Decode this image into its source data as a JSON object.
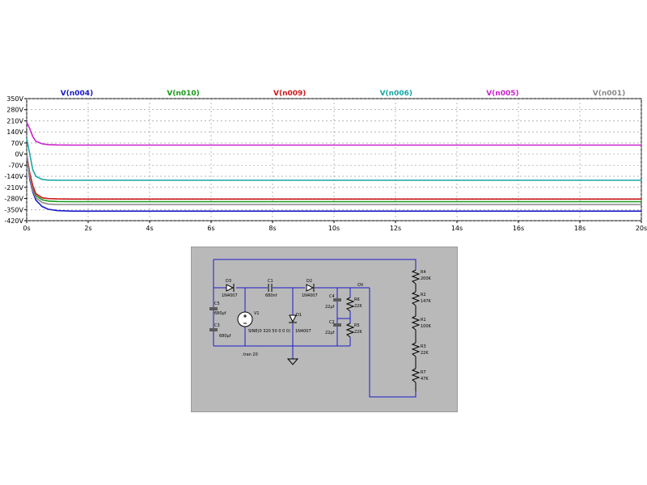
{
  "chart_data": {
    "type": "line",
    "title": "",
    "xlabel": "",
    "ylabel": "",
    "xlim": [
      0,
      20
    ],
    "ylim": [
      -420,
      350
    ],
    "x_ticks": [
      0,
      2,
      4,
      6,
      8,
      10,
      12,
      14,
      16,
      18,
      20
    ],
    "x_tick_labels": [
      "0s",
      "2s",
      "4s",
      "6s",
      "8s",
      "10s",
      "12s",
      "14s",
      "16s",
      "18s",
      "20s"
    ],
    "y_ticks": [
      350,
      280,
      210,
      140,
      70,
      0,
      -70,
      -140,
      -210,
      -280,
      -350,
      -420
    ],
    "y_tick_labels": [
      "350V",
      "280V",
      "210V",
      "140V",
      "70V",
      "0V",
      "-70V",
      "-140V",
      "-210V",
      "-280V",
      "-350V",
      "-420V"
    ],
    "grid": true,
    "legend_position": "top",
    "series": [
      {
        "name": "V(n004)",
        "color": "#1a1acc",
        "x": [
          0,
          0.1,
          0.2,
          0.3,
          0.5,
          0.7,
          1,
          1.5,
          2,
          5,
          10,
          15,
          20
        ],
        "values": [
          0,
          -160,
          -240,
          -290,
          -330,
          -348,
          -357,
          -360,
          -360,
          -360,
          -360,
          -360,
          -360
        ]
      },
      {
        "name": "V(n010)",
        "color": "#1a9a1a",
        "x": [
          0,
          0.1,
          0.2,
          0.3,
          0.5,
          0.7,
          1,
          1.5,
          2,
          5,
          10,
          15,
          20
        ],
        "values": [
          0,
          -140,
          -220,
          -262,
          -288,
          -296,
          -299,
          -300,
          -300,
          -300,
          -300,
          -300,
          -300
        ]
      },
      {
        "name": "V(n009)",
        "color": "#cc1a1a",
        "x": [
          0,
          0.1,
          0.2,
          0.3,
          0.5,
          0.7,
          1,
          1.5,
          2,
          5,
          10,
          15,
          20
        ],
        "values": [
          0,
          -120,
          -200,
          -250,
          -275,
          -281,
          -283,
          -284,
          -284,
          -284,
          -284,
          -284,
          -284
        ]
      },
      {
        "name": "V(n006)",
        "color": "#1aa6a6",
        "x": [
          0,
          0.1,
          0.2,
          0.3,
          0.5,
          0.7,
          1,
          1.5,
          2,
          5,
          10,
          15,
          20
        ],
        "values": [
          100,
          0,
          -100,
          -140,
          -160,
          -164,
          -165,
          -165,
          -165,
          -165,
          -165,
          -165,
          -165
        ]
      },
      {
        "name": "V(n005)",
        "color": "#cc22cc",
        "x": [
          0,
          0.1,
          0.2,
          0.3,
          0.5,
          0.7,
          1,
          1.5,
          2,
          5,
          10,
          15,
          20
        ],
        "values": [
          200,
          160,
          110,
          80,
          65,
          60,
          58,
          57,
          57,
          57,
          57,
          57,
          57
        ]
      },
      {
        "name": "V(n001)",
        "color": "#888888",
        "x": [
          0,
          0.1,
          0.2,
          0.3,
          0.5,
          0.7,
          1,
          1.5,
          2,
          5,
          10,
          15,
          20
        ],
        "values": [
          0,
          -150,
          -230,
          -275,
          -305,
          -315,
          -318,
          -318,
          -318,
          -318,
          -318,
          -318,
          -318
        ]
      }
    ]
  },
  "schematic": {
    "labels": {
      "d3": "D3",
      "d3_part": "1N4007",
      "c1": "C1",
      "c1_val": "680nf",
      "d2": "D2",
      "d2_part": "1N4007",
      "c5": "C5",
      "c5_val": "680µf",
      "c3": "C3",
      "c3_val": "680µf",
      "v1": "V1",
      "v1_val": "SINE(0 320 50 0 0 0)",
      "d1": "D1",
      "d1_part": "1N4007",
      "c4": "C4",
      "c4_val": "22µf",
      "c2": "C2",
      "c2_val": "22µf",
      "r6": "R6",
      "r6_val": "22K",
      "r5": "R5",
      "r5_val": "22K",
      "r4": "R4",
      "r4_val": "200K",
      "r2": "R2",
      "r2_val": "147K",
      "r1": "R1",
      "r1_val": "100K",
      "r3": "R3",
      "r3_val": "22K",
      "r7": "R7",
      "r7_val": "47K",
      "tran": ".tran 20",
      "out": "OV"
    }
  }
}
